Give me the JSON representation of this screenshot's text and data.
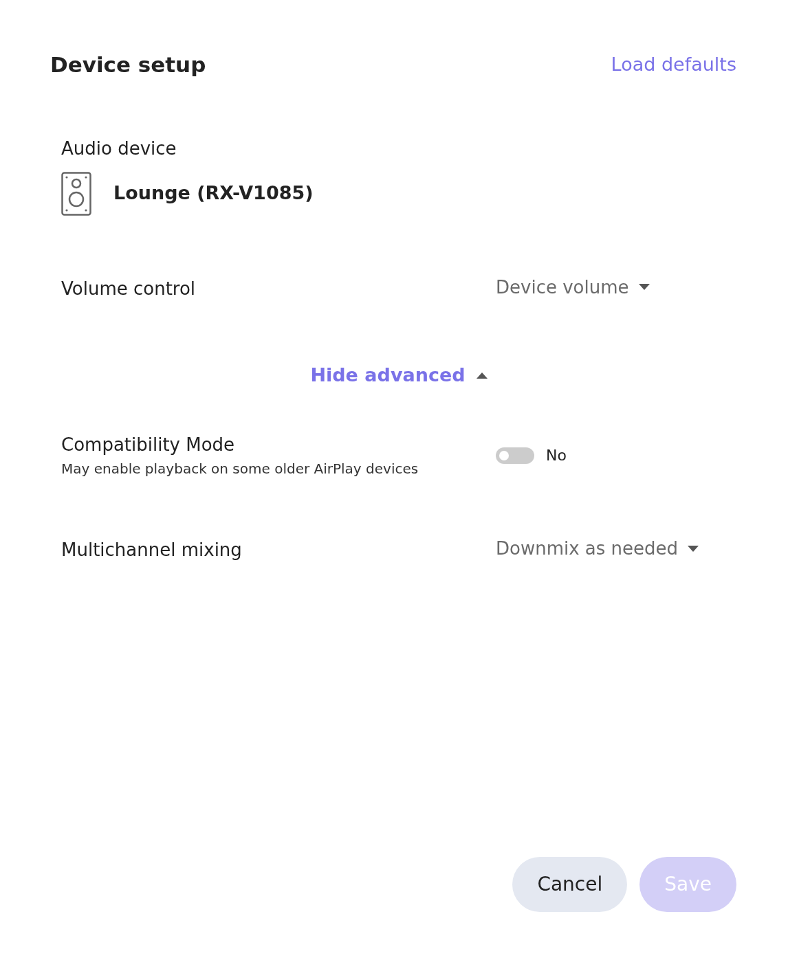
{
  "dialog": {
    "title": "Device setup",
    "load_defaults": "Load defaults"
  },
  "audio_device": {
    "label": "Audio device",
    "name": "Lounge (RX-V1085)"
  },
  "settings": [
    {
      "kind": "dropdown",
      "label": "Volume control",
      "value": "Device volume"
    }
  ],
  "advanced_toggle": {
    "label": "Hide advanced",
    "expanded": true
  },
  "advanced_settings": [
    {
      "kind": "switch",
      "label": "Compatibility Mode",
      "description": "May enable playback on some older AirPlay devices",
      "on": false,
      "value": "No"
    },
    {
      "kind": "dropdown",
      "label": "Multichannel mixing",
      "value": "Downmix as needed"
    }
  ],
  "buttons": [
    {
      "kind": "secondary",
      "label": "Cancel",
      "disabled": false
    },
    {
      "kind": "primary",
      "label": "Save",
      "disabled": true
    }
  ]
}
